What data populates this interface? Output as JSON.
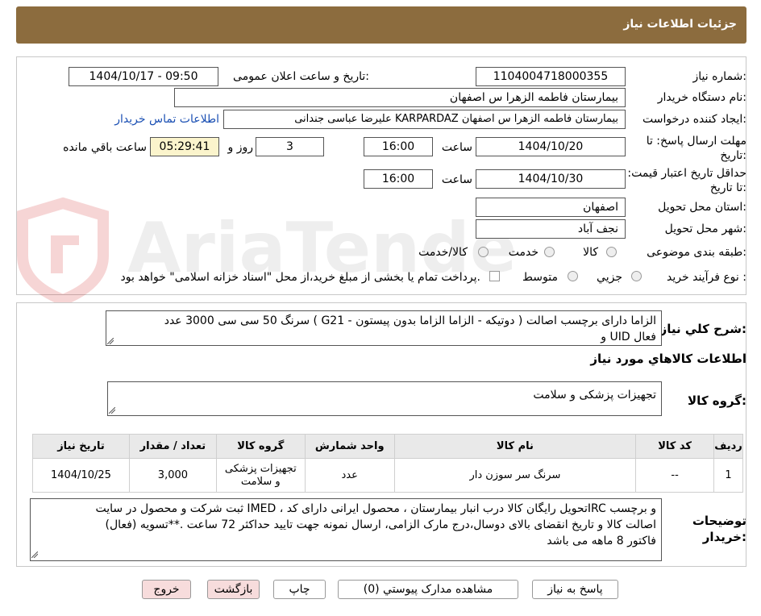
{
  "header": {
    "title": "جزئیات اطلاعات نیاز"
  },
  "watermark": {
    "text": "AriaTender.neT"
  },
  "form": {
    "need_number_label": "شماره نیاز:",
    "need_number": "1104004718000355",
    "announce_label": "تاریخ و ساعت اعلان عمومی:",
    "announce_value": "1404/10/17 - 09:50",
    "buyer_org_label": "نام دستگاه خریدار:",
    "buyer_org": "بیمارستان فاطمه الزهرا س  اصفهان",
    "creator_label": "ایجاد کننده درخواست:",
    "creator": "علیرضا عباسی جندانی KARPARDAZ بیمارستان فاطمه الزهرا س  اصفهان",
    "contact_link": "اطلاعات تماس خریدار",
    "send_deadline_label": "مهلت ارسال پاسخ: تا تاریخ:",
    "send_date": "1404/10/20",
    "time_label": "ساعت",
    "send_time": "16:00",
    "days": "3",
    "days_label": "روز و",
    "remaining": "05:29:41",
    "remaining_label": "ساعت باقي مانده",
    "validity_label": "حداقل تاریخ اعتبار قیمت: تا تاریخ:",
    "validity_date": "1404/10/30",
    "validity_time": "16:00",
    "province_label": "استان محل تحویل:",
    "province": "اصفهان",
    "city_label": "شهر محل تحویل:",
    "city": "نجف آباد",
    "category_label": "طبقه بندی موضوعی:",
    "category_options": [
      "کالا",
      "خدمت",
      "کالا/خدمت"
    ],
    "process_label": "نوع فرآیند خرید :",
    "process_options": [
      "جزیي",
      "متوسط"
    ],
    "payment_note": "پرداخت تمام یا بخشی از مبلغ خرید،از محل \"اسناد خزانه اسلامی\" خواهد بود."
  },
  "summary": {
    "label": "شرح کلي نیاز:",
    "line1": "سرنگ 50 سی سی        3000 عدد ( G21 - دوتیکه - الزاما الزاما بدون پیستون ) الزاما دارای برچسب اصالت",
    "line2": "و UID فعال"
  },
  "goods": {
    "section_title": "اطلاعات کالاهاي مورد نیاز",
    "group_label": "گروه کالا:",
    "group_value": "تجهیزات پزشکی و سلامت"
  },
  "table": {
    "headers": [
      "ردیف",
      "کد کالا",
      "نام کالا",
      "واحد شمارش",
      "گروه کالا",
      "تعداد / مقدار",
      "تاریخ نیاز"
    ],
    "rows": [
      {
        "row": "1",
        "code": "--",
        "name": "سرنگ سر سوزن دار",
        "unit": "عدد",
        "group": "تجهیزات پزشکی و سلامت",
        "qty": "3,000",
        "date": "1404/10/25"
      }
    ]
  },
  "notes": {
    "label": "توضیحات خریدار:",
    "line1": "ثبت شرکت و محصول در سایت IMED ، تحویل رایگان کالا درب انبار بیمارستان ، محصول ایرانی دارای کدIRC و برچسب",
    "line2": "(فعال) اصالت کالا و تاریخ انقضای بالای دوسال،درج مارک الزامی،  ارسال نمونه جهت تایید حداکثر 72 ساعت .**تسویه",
    "line3": "فاکتور 8 ماهه می باشد"
  },
  "buttons": {
    "reply": "پاسخ به نیاز",
    "attachments": "مشاهده مدارک پیوستي (0)",
    "print": "چاپ",
    "back": "بازگشت",
    "exit": "خروج"
  }
}
